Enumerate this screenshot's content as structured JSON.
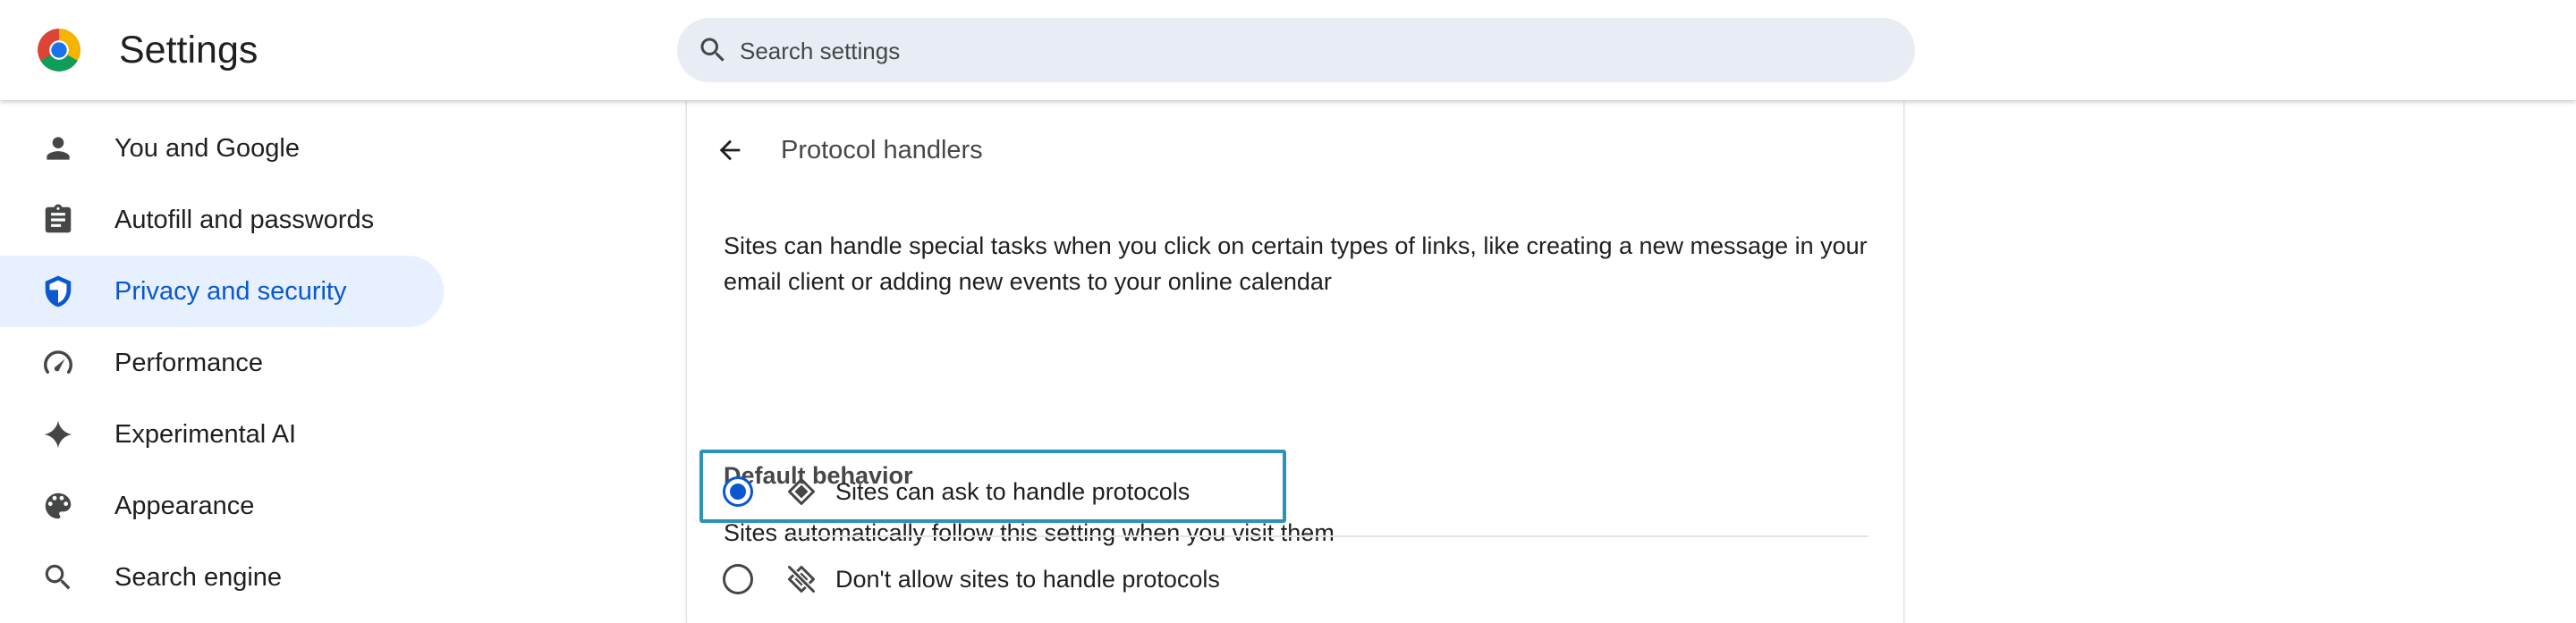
{
  "header": {
    "title": "Settings",
    "logo": "chrome-logo-icon",
    "search": {
      "placeholder": "Search settings",
      "value": "",
      "icon": "search-icon"
    }
  },
  "sidebar": {
    "items": [
      {
        "label": "You and Google",
        "icon": "person-icon",
        "active": false
      },
      {
        "label": "Autofill and passwords",
        "icon": "clipboard-icon",
        "active": false
      },
      {
        "label": "Privacy and security",
        "icon": "shield-icon",
        "active": true
      },
      {
        "label": "Performance",
        "icon": "speedometer-icon",
        "active": false
      },
      {
        "label": "Experimental AI",
        "icon": "sparkle-icon",
        "active": false
      },
      {
        "label": "Appearance",
        "icon": "palette-icon",
        "active": false
      },
      {
        "label": "Search engine",
        "icon": "search-icon",
        "active": false
      }
    ]
  },
  "main": {
    "back_icon": "back-arrow-icon",
    "title": "Protocol handlers",
    "description": "Sites can handle special tasks when you click on certain types of links, like creating a new message in your email client or adding new events to your online calendar",
    "default_behavior": {
      "heading": "Default behavior",
      "subheading": "Sites automatically follow this setting when you visit them",
      "options": [
        {
          "label": "Sites can ask to handle protocols",
          "icon": "protocol-handler-icon",
          "selected": true
        },
        {
          "label": "Don't allow sites to handle protocols",
          "icon": "protocol-handler-off-icon",
          "selected": false
        }
      ]
    }
  },
  "colors": {
    "accent": "#0b57d0",
    "active_nav_bg": "#e7f0fe",
    "search_bg": "#e8edf5",
    "highlight_box": "#2d92b8"
  }
}
